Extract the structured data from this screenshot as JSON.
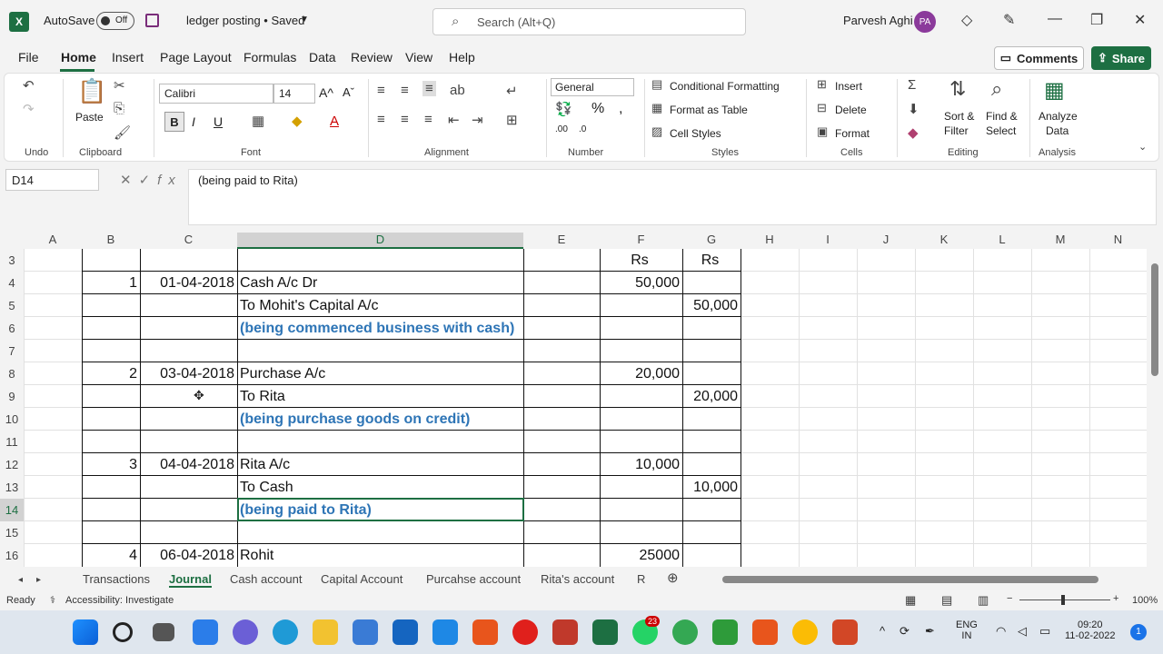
{
  "titlebar": {
    "autosave": "AutoSave",
    "autosave_state": "Off",
    "doc_title": "ledger posting • Saved",
    "search_placeholder": "Search (Alt+Q)",
    "user_name": "Parvesh Aghi",
    "user_initials": "PA"
  },
  "menu": [
    "File",
    "Home",
    "Insert",
    "Page Layout",
    "Formulas",
    "Data",
    "Review",
    "View",
    "Help"
  ],
  "buttons": {
    "comments": "Comments",
    "share": "Share"
  },
  "ribbon": {
    "undo_group": "Undo",
    "clipboard_group": "Clipboard",
    "paste": "Paste",
    "font_group": "Font",
    "font_name": "Calibri",
    "font_size": "14",
    "alignment_group": "Alignment",
    "number_group": "Number",
    "number_format": "General",
    "styles_group": "Styles",
    "conditional_formatting": "Conditional Formatting",
    "format_as_table": "Format as Table",
    "cell_styles": "Cell Styles",
    "cells_group": "Cells",
    "insert": "Insert",
    "delete": "Delete",
    "format": "Format",
    "editing_group": "Editing",
    "sort_filter": "Sort &",
    "sort_filter2": "Filter",
    "find_select": "Find &",
    "find_select2": "Select",
    "analysis_group": "Analysis",
    "analyze_data": "Analyze",
    "analyze_data2": "Data"
  },
  "formula": {
    "namebox": "D14",
    "content": "(being paid to Rita)"
  },
  "columns": [
    "A",
    "B",
    "C",
    "D",
    "E",
    "F",
    "G",
    "H",
    "I",
    "J",
    "K",
    "L",
    "M",
    "N"
  ],
  "rows": [
    "3",
    "4",
    "5",
    "6",
    "7",
    "8",
    "9",
    "10",
    "11",
    "12",
    "13",
    "14",
    "15",
    "16"
  ],
  "cells": {
    "r3": {
      "f": "Rs",
      "g": "Rs"
    },
    "r4": {
      "b": "1",
      "c": "01-04-2018",
      "d": "Cash A/c  Dr",
      "f": "50,000"
    },
    "r5": {
      "d": "To Mohit's Capital A/c",
      "g": "50,000"
    },
    "r6": {
      "d": "(being commenced  business with cash)"
    },
    "r8": {
      "b": "2",
      "c": "03-04-2018",
      "d": "Purchase A/c",
      "f": "20,000"
    },
    "r9": {
      "d": "To Rita",
      "g": "20,000"
    },
    "r10": {
      "d": "(being purchase goods on credit)"
    },
    "r12": {
      "b": "3",
      "c": "04-04-2018",
      "d": "Rita A/c",
      "f": "10,000"
    },
    "r13": {
      "d": "To Cash",
      "g": "10,000"
    },
    "r14": {
      "d": "(being paid to Rita)"
    },
    "r16": {
      "b": "4",
      "c": "06-04-2018",
      "d": "Rohit",
      "f": "25000"
    }
  },
  "sheets": [
    "Transactions",
    "Journal",
    "Cash account",
    "Capital Account",
    "Purcahse account",
    "Rita's account",
    "R"
  ],
  "status": {
    "ready": "Ready",
    "accessibility": "Accessibility: Investigate",
    "zoom": "100%"
  },
  "taskbar": {
    "lang1": "ENG",
    "lang2": "IN",
    "time": "09:20",
    "date": "11-02-2022",
    "whatsapp_badge": "23",
    "notif": "1"
  }
}
